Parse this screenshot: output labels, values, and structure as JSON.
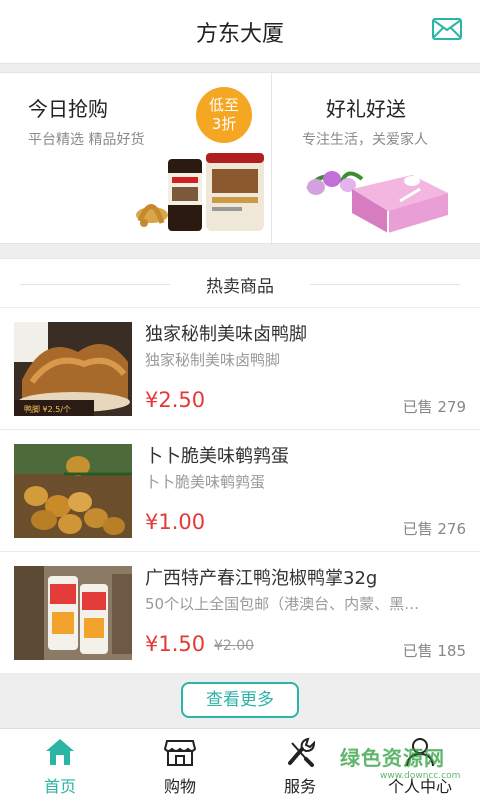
{
  "header": {
    "title": "方东大厦"
  },
  "promo": {
    "left": {
      "title": "今日抢购",
      "subtitle": "平台精选 精品好货",
      "badge_line1": "低至",
      "badge_line2": "3折"
    },
    "right": {
      "title": "好礼好送",
      "subtitle": "专注生活，关爱家人"
    }
  },
  "hot": {
    "title": "热卖商品"
  },
  "products": [
    {
      "name": "独家秘制美味卤鸭脚",
      "desc": "独家秘制美味卤鸭脚",
      "price": "¥2.50",
      "old_price": "",
      "sold": "已售 279"
    },
    {
      "name": "卜卜脆美味鹌鹑蛋",
      "desc": "卜卜脆美味鹌鹑蛋",
      "price": "¥1.00",
      "old_price": "",
      "sold": "已售 276"
    },
    {
      "name": "广西特产春江鸭泡椒鸭掌32g",
      "desc": "50个以上全国包邮（港澳台、内蒙、黑…",
      "price": "¥1.50",
      "old_price": "¥2.00",
      "sold": "已售 185"
    }
  ],
  "more_button": "查看更多",
  "nav": {
    "items": [
      {
        "label": "首页",
        "icon": "home-icon",
        "active": true
      },
      {
        "label": "购物",
        "icon": "shop-icon",
        "active": false
      },
      {
        "label": "服务",
        "icon": "tools-icon",
        "active": false
      },
      {
        "label": "个人中心",
        "icon": "user-icon",
        "active": false
      }
    ]
  },
  "watermark": {
    "text": "绿色资源网",
    "sub": "www.downcc.com"
  },
  "colors": {
    "accent": "#2bb5a5",
    "price": "#e53935",
    "badge": "#f5a623"
  }
}
